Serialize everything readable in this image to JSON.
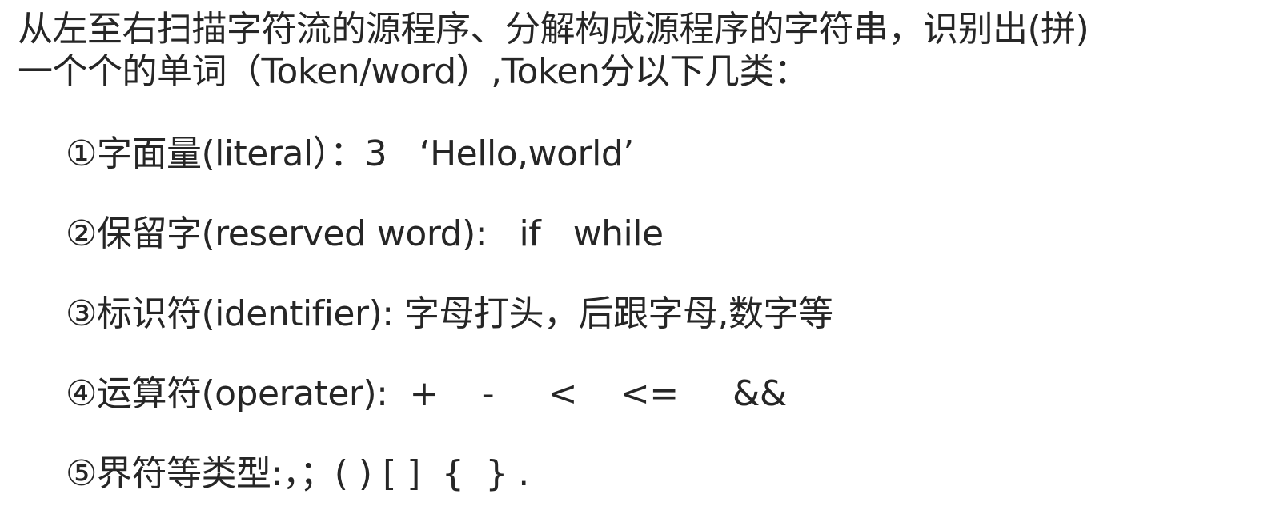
{
  "intro": {
    "line1": "从左至右扫描字符流的源程序、分解构成源程序的字符串，识别出(拼)",
    "line2": "一个个的单词（Token/word）,Token分以下几类："
  },
  "items": [
    {
      "text": "①字面量(literal）：3   ‘Hello,world’"
    },
    {
      "text": "②保留字(reserved word):   if   while"
    },
    {
      "text": "③标识符(identifier): 字母打头，后跟字母,数字等"
    },
    {
      "text": "④运算符(operater):  +    -     <    <=     &&"
    },
    {
      "text": "⑤界符等类型:，；( ) [ ]  {  } ."
    }
  ]
}
